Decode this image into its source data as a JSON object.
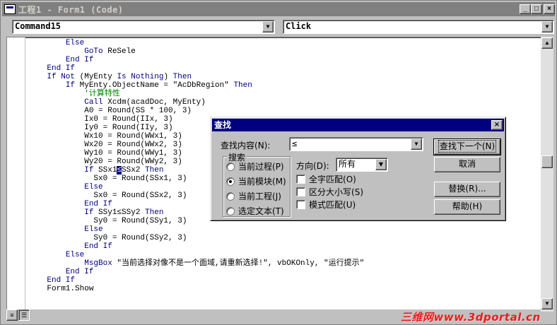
{
  "window": {
    "title": "工程1 - Form1 (Code)",
    "minimize_glyph": "_",
    "maximize_glyph": "□",
    "close_glyph": "×"
  },
  "object_combo": {
    "value": "Command15"
  },
  "procedure_combo": {
    "value": "Click"
  },
  "code_lines": [
    [
      {
        "t": "        "
      },
      {
        "t": "Else",
        "k": "kw"
      }
    ],
    [
      {
        "t": "            "
      },
      {
        "t": "GoTo",
        "k": "kw"
      },
      {
        "t": " ReSele"
      }
    ],
    [
      {
        "t": "        "
      },
      {
        "t": "End If",
        "k": "kw"
      }
    ],
    [
      {
        "t": "    "
      },
      {
        "t": "End If",
        "k": "kw"
      }
    ],
    [
      {
        "t": "    "
      },
      {
        "t": "If Not",
        "k": "kw"
      },
      {
        "t": " (MyEnty "
      },
      {
        "t": "Is Nothing",
        "k": "kw"
      },
      {
        "t": ") "
      },
      {
        "t": "Then",
        "k": "kw"
      }
    ],
    [
      {
        "t": "        "
      },
      {
        "t": "If",
        "k": "kw"
      },
      {
        "t": " MyEnty.ObjectName = \"AcDbRegion\" "
      },
      {
        "t": "Then",
        "k": "kw"
      }
    ],
    [
      {
        "t": "            "
      },
      {
        "t": "'计算特性",
        "k": "cm"
      }
    ],
    [
      {
        "t": "            "
      },
      {
        "t": "Call",
        "k": "kw"
      },
      {
        "t": " Xcdm(acadDoc, MyEnty)"
      }
    ],
    [
      {
        "t": "            A0 = Round(SS * 100, 3)"
      }
    ],
    [
      {
        "t": "            Ix0 = Round(IIx, 3)"
      }
    ],
    [
      {
        "t": "            Iy0 = Round(IIy, 3)"
      }
    ],
    [
      {
        "t": "            Wx10 = Round(WWx1, 3)"
      }
    ],
    [
      {
        "t": "            Wx20 = Round(WWx2, 3)"
      }
    ],
    [
      {
        "t": "            Wy10 = Round(WWy1, 3)"
      }
    ],
    [
      {
        "t": "            Wy20 = Round(WWy2, 3)"
      }
    ],
    [
      {
        "t": "            "
      },
      {
        "t": "If",
        "k": "kw"
      },
      {
        "t": " SSx1"
      },
      {
        "t": "≤",
        "k": "hl"
      },
      {
        "t": "SSx2 "
      },
      {
        "t": "Then",
        "k": "kw"
      }
    ],
    [
      {
        "t": "              Sx0 = Round(SSx1, 3)"
      }
    ],
    [
      {
        "t": "            "
      },
      {
        "t": "Else",
        "k": "kw"
      }
    ],
    [
      {
        "t": "              Sx0 = Round(SSx2, 3)"
      }
    ],
    [
      {
        "t": "            "
      },
      {
        "t": "End If",
        "k": "kw"
      }
    ],
    [
      {
        "t": "            "
      },
      {
        "t": "If",
        "k": "kw"
      },
      {
        "t": " SSy1≤SSy2 "
      },
      {
        "t": "Then",
        "k": "kw"
      }
    ],
    [
      {
        "t": "              Sy0 = Round(SSy1, 3)"
      }
    ],
    [
      {
        "t": "            "
      },
      {
        "t": "Else",
        "k": "kw"
      }
    ],
    [
      {
        "t": "              Sy0 = Round(SSy2, 3)"
      }
    ],
    [
      {
        "t": "            "
      },
      {
        "t": "End If",
        "k": "kw"
      }
    ],
    [
      {
        "t": "        "
      },
      {
        "t": "Else",
        "k": "kw"
      }
    ],
    [
      {
        "t": "            "
      },
      {
        "t": "MsgBox",
        "k": "kw"
      },
      {
        "t": " \"当前选择对像不是一个面域,请重新选择!\", vbOKOnly, \"运行提示\""
      }
    ],
    [
      {
        "t": "        "
      },
      {
        "t": "End If",
        "k": "kw"
      }
    ],
    [
      {
        "t": "    "
      },
      {
        "t": "End If",
        "k": "kw"
      }
    ],
    [
      {
        "t": "    Form1.Show"
      }
    ]
  ],
  "find_dialog": {
    "title": "查找",
    "close_glyph": "×",
    "find_what_label": "查找内容",
    "find_what_key": "(N):",
    "find_what_value": "≤",
    "search_group_label": "搜索",
    "scope_options": [
      {
        "label": "当前过程",
        "key": "(P)",
        "selected": false
      },
      {
        "label": "当前模块",
        "key": "(M)",
        "selected": true
      },
      {
        "label": "当前工程",
        "key": "(J)",
        "selected": false
      },
      {
        "label": "选定文本",
        "key": "(T)",
        "selected": false
      }
    ],
    "direction_label": "方向",
    "direction_key": "(D):",
    "direction_value": "所有",
    "checkboxes": [
      {
        "label": "全字匹配",
        "key": "(O)",
        "checked": false
      },
      {
        "label": "区分大小写",
        "key": "(S)",
        "checked": false
      },
      {
        "label": "模式匹配",
        "key": "(U)",
        "checked": false
      }
    ],
    "buttons": {
      "find_next": "查找下一个(N)",
      "cancel": "取消",
      "replace": "替换(R)...",
      "help": "帮助(H)"
    }
  },
  "watermark": "三维网www.3dportal.cn",
  "colors": {
    "keyword": "#000080",
    "comment": "#008000",
    "dialog_title_bg": "#000080",
    "inactive_title_bg": "#808080",
    "watermark": "#e02020"
  }
}
